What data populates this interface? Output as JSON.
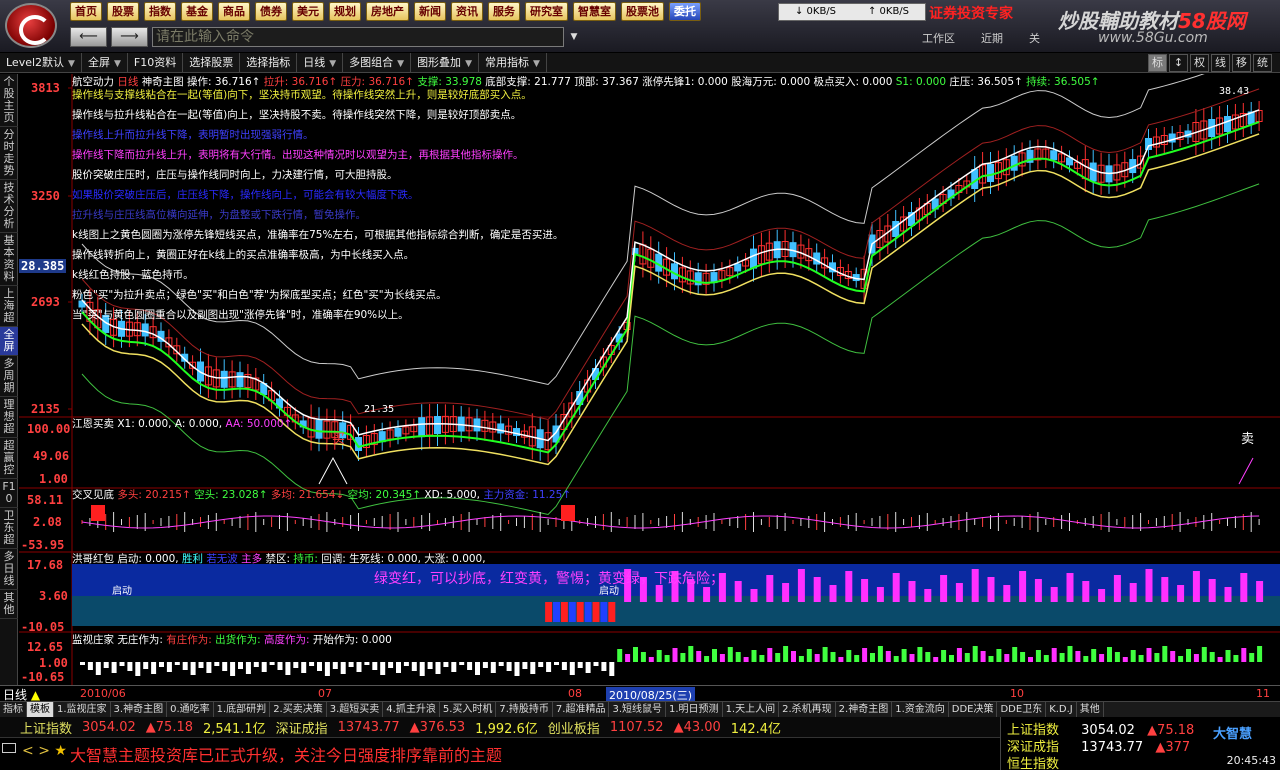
{
  "menu": [
    "首页",
    "股票",
    "指数",
    "基金",
    "商品",
    "债券",
    "美元",
    "规划",
    "房地产",
    "新闻",
    "资讯",
    "服务",
    "研究室",
    "智慧室",
    "股票池",
    "委托"
  ],
  "command": {
    "placeholder": "请在此输入命令"
  },
  "speed": {
    "down": "0KB/S",
    "up": "0KB/S"
  },
  "brand_red": "证券投资专家",
  "watermark": {
    "title": "炒股輔助教材",
    "brand": "58股网",
    "url": "www.58Gu.com"
  },
  "topright": [
    "工作区",
    "近期",
    "关"
  ],
  "toolbar": [
    "Level2默认",
    "全屏",
    "F10资料",
    "选择股票",
    "选择指标",
    "日线",
    "多图组合",
    "图形叠加",
    "常用指标"
  ],
  "toolbar_right": [
    "标",
    "↕",
    "权",
    "线",
    "移",
    "统"
  ],
  "vtabs": [
    "个股主页",
    "分时走势",
    "技术分析",
    "基本资料",
    "上海超",
    "全屏",
    "多周期",
    "理想超",
    "超赢控",
    "F10",
    "卫东超",
    "多日线",
    "其他"
  ],
  "price_axis": {
    "p1": "3813",
    "p2": "3250",
    "p3": "2693",
    "p4": "2135",
    "cur": "28.385"
  },
  "main_indicator": {
    "name": "航空动力",
    "period": "日线",
    "tpl": "神奇主图",
    "caozuo": "操作: 36.716↑",
    "lashang": "拉升: 36.716↑",
    "yali": "压力: 36.716↑",
    "zhicheng": "支撑: 33.978",
    "dibu": "底部支撑: 21.777",
    "dingbu": "顶部: 37.367",
    "zhangting": "涨停先锋1: 0.000",
    "guhai": "股海万元: 0.000",
    "jidian": "极点买入: 0.000",
    "s1": "S1: 0.000",
    "zhuangya": "庄压: 36.505↑",
    "kuaixian": "持续: 36.505↑",
    "highlbl": "38.43",
    "lowlbl": "21.35"
  },
  "annotations": [
    {
      "t": "操作线与支撑线粘合在一起(等值)向下，坚决持币观望。待操作线突然上升，则是较好底部买入点。",
      "c": "#f0f040"
    },
    {
      "t": "操作线与拉升线粘合在一起(等值)向上，坚决持股不卖。待操作线突然下降，则是较好顶部卖点。",
      "c": "#ffffff"
    },
    {
      "t": "操作线上升而拉升线下降，表明暂时出现强弱行情。",
      "c": "#4040ff"
    },
    {
      "t": "操作线下降而拉升线上升，表明将有大行情。出现这种情况时以观望为主，再根据其他指标操作。",
      "c": "#ff40ff"
    },
    {
      "t": "股价突破庄压时，庄压与操作线同时向上，力决建行情，可大胆持股。",
      "c": "#ffffff"
    },
    {
      "t": "如果股价突破庄压后，庄压线下降，操作线向上，可能会有较大幅度下跌。",
      "c": "#2a2aff"
    },
    {
      "t": "拉升线与庄压线高位横向延伸，为盘整或下跌行情，暂免操作。",
      "c": "#3a3ac8"
    },
    {
      "t": "k线图上之黄色圆圈为涨停先锋短线买点，准确率在75%左右，可根据其他指标综合判断，确定是否买进。",
      "c": "#ffffff"
    },
    {
      "t": "操作线转折向上，黄圈正好在k线上的买点准确率极高，为中长线买入点。",
      "c": "#ffffff"
    },
    {
      "t": "k线红色持股，蓝色持币。",
      "c": "#ffffff"
    },
    {
      "t": "粉色\"买\"为拉升卖点；绿色\"买\"和白色\"荐\"为探底型买点；红色\"买\"为长线买点。",
      "c": "#ffffff"
    },
    {
      "t": "当\"买\"与黄色圆圈重合以及副图出现\"涨停先锋\"时，准确率在90%以上。",
      "c": "#ffffff"
    }
  ],
  "panel1": {
    "name": "江恩买卖",
    "x1": "X1: 0.000,",
    "a": "A: 0.000,",
    "aa": "AA: 50.000↑",
    "y1": "100.00",
    "y2": "49.06",
    "y3": "1.00",
    "buy": "买",
    "sell": "卖"
  },
  "panel2": {
    "name": "交叉见底",
    "duo": "多头: 20.215↑",
    "kong": "空头: 23.028↑",
    "duojun": "多均: 21.654↓",
    "kongjun": "空均: 20.345↑",
    "xd": "XD: 5.000,",
    "zhuli": "主力资金: 11.25↑",
    "y1": "58.11",
    "y2": "2.08",
    "y3": "-53.95"
  },
  "panel3": {
    "name": "洪哥红包",
    "qidong": "启动: 0.000,",
    "shengli": "胜利",
    "ruochao": "若无波",
    "zhuduo": "主多",
    "jinqu": "禁区:",
    "chibi": "持币:",
    "huitiao": "回调:",
    "shengsi": "生死线: 0.000,",
    "dazhang": "大涨: 0.000,",
    "banner": "绿变红，可以抄底，红变黄，警惕；黄变绿，下跌危险；",
    "y1": "17.68",
    "y2": "3.60",
    "y3": "-10.05",
    "label": "启动"
  },
  "panel4": {
    "name": "监视庄家",
    "wuzhuang": "无庄作为:",
    "youzhuang": "有庄作为:",
    "chuhuo": "出货作为:",
    "gaodu": "高度作为:",
    "kaishi": "开始作为: 0.000",
    "y1": "12.65",
    "y2": "1.00",
    "y3": "-10.65"
  },
  "dates": {
    "period": "日线",
    "d1": "2010/06",
    "d2": "07",
    "d3": "08",
    "current": "2010/08/25(三)",
    "d4": "10",
    "d5": "11"
  },
  "formula_tabs": [
    "指标",
    "模板",
    "1.监视庄家",
    "3.神奇主图",
    "0.通吃率",
    "1.底部研判",
    "2.买卖决策",
    "3.超短买卖",
    "4.抓主升浪",
    "5.买入时机",
    "7.持股持币",
    "7.超准精品",
    "3.短线鼠号",
    "1.明日预测",
    "1.天上人间",
    "2.杀机再现",
    "2.神奇主图",
    "1.资金流向",
    "DDE决策",
    "DDE卫东",
    "K.D.J",
    "其他"
  ],
  "indices": {
    "sh_name": "上证指数",
    "sh_val": "3054.02",
    "sh_chg": "▲75.18",
    "sh_amt": "2,541.1亿",
    "sz_name": "深证成指",
    "sz_val": "13743.77",
    "sz_chg": "▲376.53",
    "sz_amt": "1,992.6亿",
    "cy_name": "创业板指",
    "cy_val": "1107.52",
    "cy_chg": "▲43.00",
    "cy_amt": "142.4亿"
  },
  "ticker": "大智慧主题投资库已正式升级，关注今日强度排序靠前的主题",
  "rpanel": {
    "r1n": "上证指数",
    "r1v": "3054.02",
    "r1c": "▲75.18",
    "r2n": "深证成指",
    "r2v": "13743.77",
    "r2c": "▲377",
    "r3n": "恒生指数",
    "logo": "大智慧",
    "time": "20:45:43"
  }
}
